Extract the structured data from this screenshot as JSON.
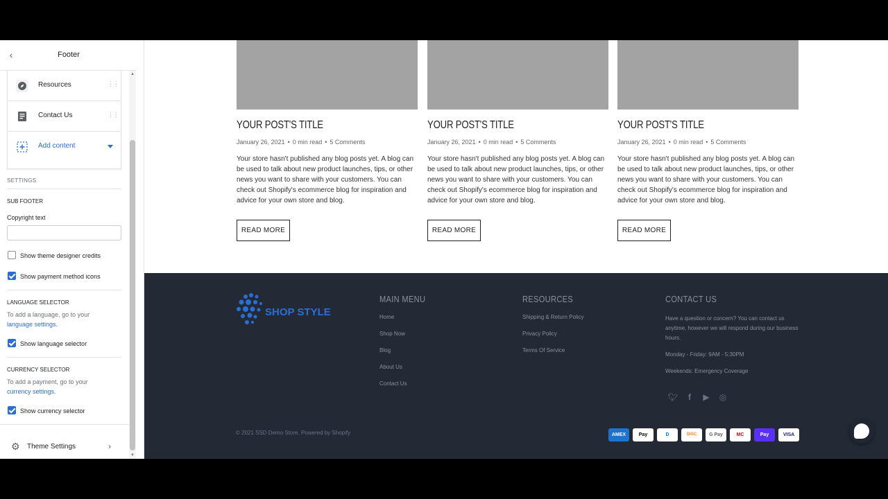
{
  "sidebar": {
    "title": "Footer",
    "blocks": [
      {
        "label": "Resources",
        "icon": "compass-icon"
      },
      {
        "label": "Contact Us",
        "icon": "document-icon"
      }
    ],
    "add_content": "Add content",
    "settings_heading": "SETTINGS",
    "sub_footer_heading": "SUB FOOTER",
    "copyright_label": "Copyright text",
    "copyright_value": "",
    "show_credits": "Show theme designer credits",
    "show_payment_icons": "Show payment method icons",
    "language_heading": "LANGUAGE SELECTOR",
    "language_help": "To add a language, go to your",
    "language_link": "language settings.",
    "show_language": "Show language selector",
    "currency_heading": "CURRENCY SELECTOR",
    "currency_help": "To add a payment, go to your",
    "currency_link": "currency settings.",
    "show_currency": "Show currency selector",
    "checks": {
      "credits": false,
      "payment_icons": true,
      "language": true,
      "currency": true
    },
    "theme_settings": "Theme Settings"
  },
  "posts": [
    {
      "title": "YOUR POST'S TITLE",
      "date": "January 26, 2021",
      "read": "0 min read",
      "comments": "5 Comments",
      "excerpt": "Your store hasn't published any blog posts yet. A blog can be used to talk about new product launches, tips, or other news you want to share with your customers. You can check out Shopify's ecommerce blog for inspiration and advice for your own store and blog.",
      "button": "READ MORE"
    },
    {
      "title": "YOUR POST'S TITLE",
      "date": "January 26, 2021",
      "read": "0 min read",
      "comments": "5 Comments",
      "excerpt": "Your store hasn't published any blog posts yet. A blog can be used to talk about new product launches, tips, or other news you want to share with your customers. You can check out Shopify's ecommerce blog for inspiration and advice for your own store and blog.",
      "button": "READ MORE"
    },
    {
      "title": "YOUR POST'S TITLE",
      "date": "January 26, 2021",
      "read": "0 min read",
      "comments": "5 Comments",
      "excerpt": "Your store hasn't published any blog posts yet. A blog can be used to talk about new product launches, tips, or other news you want to share with your customers. You can check out Shopify's ecommerce blog for inspiration and advice for your own store and blog.",
      "button": "READ MORE"
    }
  ],
  "footer": {
    "logo_text": "SHOP STYLE",
    "main_menu": {
      "heading": "MAIN MENU",
      "links": [
        "Home",
        "Shop Now",
        "Blog",
        "About Us",
        "Contact Us"
      ]
    },
    "resources": {
      "heading": "RESOURCES",
      "links": [
        "Shipping & Return Policy",
        "Privacy Policy",
        "Terms Of Service"
      ]
    },
    "contact": {
      "heading": "CONTACT US",
      "text": "Have a question or concern? You can contact us anytime, however we will respond during our business hours.",
      "hours": "Monday - Friday: 9AM - 5:30PM",
      "weekends": "Weekends: Emergency Coverage"
    },
    "copyright": "© 2021 SSD Demo Store. Powered by Shopify",
    "payments": [
      {
        "name": "AMEX",
        "color": "#1f72cd"
      },
      {
        "name": "Pay",
        "color": "#ffffff"
      },
      {
        "name": "D",
        "color": "#ffffff"
      },
      {
        "name": "DISC",
        "color": "#ffffff"
      },
      {
        "name": "G Pay",
        "color": "#ffffff"
      },
      {
        "name": "MC",
        "color": "#ffffff"
      },
      {
        "name": "Pay",
        "color": "#5a31f4"
      },
      {
        "name": "VISA",
        "color": "#ffffff"
      }
    ]
  }
}
